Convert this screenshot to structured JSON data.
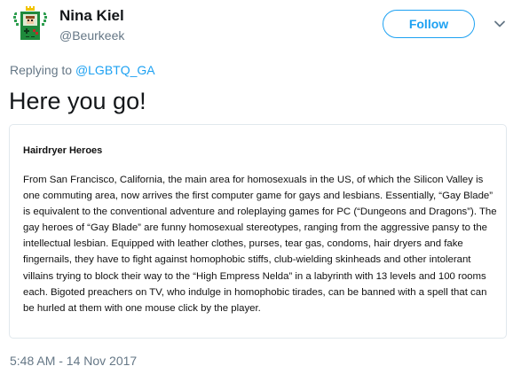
{
  "tweet": {
    "author": {
      "display_name": "Nina Kiel",
      "handle": "@Beurkeek",
      "avatar_icon": "pixel-game-console-avatar"
    },
    "follow_label": "Follow",
    "menu_icon": "chevron-down-icon",
    "replying_prefix": "Replying to ",
    "replying_to": "@LGBTQ_GA",
    "text": "Here you go!",
    "attachment": {
      "heading": "Hairdryer Heroes",
      "body": "From San Francisco, California, the main area for homosexuals in the US, of which the Silicon Valley is one commuting area, now arrives the first computer game for gays and lesbians. Essentially, “Gay Blade” is equivalent to the conventional adventure and roleplaying games for PC (“Dungeons and Dragons”). The gay heroes of “Gay Blade” are funny homosexual stereotypes, ranging from the aggressive pansy to the intellectual lesbian. Equipped with leather clothes, purses, tear gas, condoms, hair dryers and fake fingernails, they have to fight against homophobic stiffs, club-wielding skinheads and other intolerant villains trying to block their way to the “High Empress Nelda” in a labyrinth with 13 levels and 100 rooms each.  Bigoted preachers on TV, who indulge in homophobic tirades, can be banned with a spell that can be hurled at them with one mouse click by the player."
    },
    "timestamp": "5:48 AM - 14 Nov 2017"
  },
  "colors": {
    "accent": "#1da1f2",
    "secondary_text": "#657786",
    "border": "#e1e8ed",
    "avatar_green": "#1f8a3c"
  }
}
